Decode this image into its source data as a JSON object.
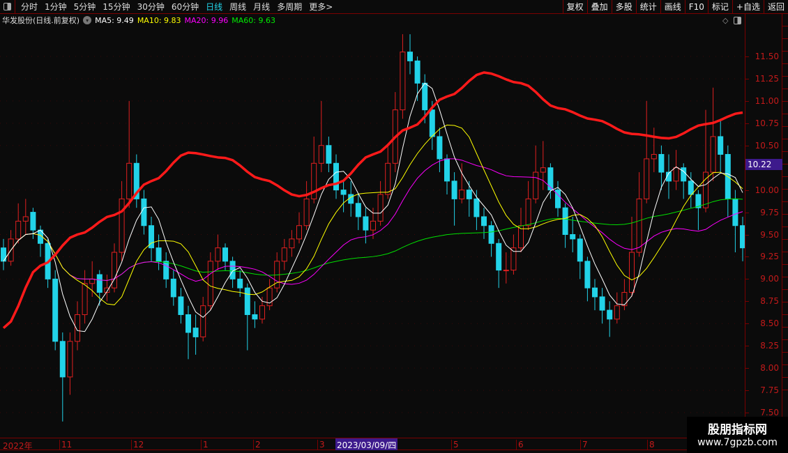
{
  "toolbar": {
    "periods": [
      "分时",
      "1分钟",
      "5分钟",
      "15分钟",
      "30分钟",
      "60分钟",
      "日线",
      "周线",
      "月线",
      "多周期",
      "更多>"
    ],
    "active_period": "日线",
    "buttons": [
      "复权",
      "叠加",
      "多股",
      "统计",
      "画线",
      "F10",
      "标记",
      "+自选",
      "返回"
    ]
  },
  "info": {
    "title": "华发股份(日线.前复权)",
    "ma5": "MA5: 9.49",
    "ma10": "MA10: 9.83",
    "ma20": "MA20: 9.96",
    "ma60": "MA60: 9.63"
  },
  "colors": {
    "up": "#e02020",
    "down": "#22d3e8",
    "ma5": "#ffffff",
    "ma10": "#ffff00",
    "ma20": "#ff00ff",
    "ma60": "#00e000",
    "thick_line": "#ff1a1a",
    "axis": "#c41a1a",
    "cursor": "#3d1a8c"
  },
  "price_axis": {
    "ticks": [
      "11.50",
      "11.25",
      "11.00",
      "10.75",
      "10.50",
      "10.00",
      "9.75",
      "9.50",
      "9.25",
      "9.00",
      "8.75",
      "8.50",
      "8.25",
      "8.00",
      "7.75",
      "7.50"
    ],
    "cursor_price": "10.22"
  },
  "time_axis": {
    "labels": [
      "2022年",
      "11",
      "12",
      "1",
      "2",
      "3",
      "4",
      "5",
      "6",
      "7",
      "8"
    ],
    "cursor_date": "2023/03/09/四"
  },
  "watermark": {
    "line1": "股朋指标网",
    "line2": "www.7gpzb.com"
  },
  "chart_data": {
    "type": "candlestick",
    "ylim": [
      7.5,
      11.5
    ],
    "bars": [
      [
        9.35,
        9.45,
        9.1,
        9.2
      ],
      [
        9.2,
        9.55,
        9.15,
        9.45
      ],
      [
        9.45,
        9.85,
        9.4,
        9.65
      ],
      [
        9.65,
        9.9,
        9.5,
        9.7
      ],
      [
        9.75,
        9.8,
        9.45,
        9.55
      ],
      [
        9.55,
        9.6,
        9.25,
        9.4
      ],
      [
        9.4,
        9.45,
        8.9,
        9.0
      ],
      [
        9.0,
        9.1,
        8.2,
        8.3
      ],
      [
        8.3,
        8.4,
        7.4,
        7.9
      ],
      [
        7.9,
        8.4,
        7.7,
        8.3
      ],
      [
        8.3,
        8.75,
        8.2,
        8.6
      ],
      [
        8.6,
        9.1,
        8.5,
        8.95
      ],
      [
        8.95,
        9.2,
        8.8,
        9.0
      ],
      [
        9.05,
        9.1,
        8.7,
        8.85
      ],
      [
        8.85,
        9.05,
        8.75,
        8.9
      ],
      [
        8.9,
        9.4,
        8.85,
        9.3
      ],
      [
        9.3,
        10.1,
        9.2,
        9.9
      ],
      [
        9.9,
        11.0,
        9.8,
        10.3
      ],
      [
        10.3,
        10.4,
        9.8,
        9.9
      ],
      [
        9.9,
        10.0,
        9.5,
        9.6
      ],
      [
        9.6,
        9.7,
        9.2,
        9.35
      ],
      [
        9.35,
        9.5,
        9.1,
        9.2
      ],
      [
        9.2,
        9.3,
        8.9,
        9.0
      ],
      [
        9.0,
        9.1,
        8.7,
        8.8
      ],
      [
        8.8,
        8.9,
        8.5,
        8.6
      ],
      [
        8.6,
        8.7,
        8.1,
        8.4
      ],
      [
        8.45,
        8.6,
        8.15,
        8.35
      ],
      [
        8.35,
        8.8,
        8.3,
        8.7
      ],
      [
        8.7,
        9.3,
        8.65,
        9.2
      ],
      [
        9.2,
        9.5,
        9.1,
        9.35
      ],
      [
        9.35,
        9.4,
        9.1,
        9.2
      ],
      [
        9.2,
        9.25,
        8.9,
        9.0
      ],
      [
        9.0,
        9.1,
        8.8,
        8.9
      ],
      [
        8.9,
        8.95,
        8.2,
        8.6
      ],
      [
        8.6,
        8.75,
        8.45,
        8.55
      ],
      [
        8.55,
        8.8,
        8.5,
        8.7
      ],
      [
        8.7,
        9.0,
        8.65,
        8.9
      ],
      [
        8.9,
        9.3,
        8.85,
        9.2
      ],
      [
        9.2,
        9.45,
        9.1,
        9.35
      ],
      [
        9.35,
        9.55,
        9.25,
        9.45
      ],
      [
        9.45,
        9.75,
        9.4,
        9.6
      ],
      [
        9.6,
        10.1,
        9.55,
        9.9
      ],
      [
        9.9,
        10.6,
        9.85,
        10.3
      ],
      [
        10.3,
        11.0,
        10.2,
        10.5
      ],
      [
        10.5,
        10.6,
        10.2,
        10.3
      ],
      [
        10.3,
        10.4,
        9.9,
        10.0
      ],
      [
        10.0,
        10.1,
        9.75,
        9.95
      ],
      [
        9.95,
        10.1,
        9.7,
        9.85
      ],
      [
        9.85,
        9.95,
        9.55,
        9.7
      ],
      [
        9.7,
        9.8,
        9.4,
        9.55
      ],
      [
        9.55,
        9.8,
        9.45,
        9.65
      ],
      [
        9.65,
        10.1,
        9.6,
        9.95
      ],
      [
        9.95,
        10.5,
        9.9,
        10.3
      ],
      [
        10.3,
        11.1,
        10.2,
        10.9
      ],
      [
        10.9,
        11.75,
        10.8,
        11.55
      ],
      [
        11.55,
        11.75,
        11.3,
        11.45
      ],
      [
        11.45,
        11.5,
        11.0,
        11.2
      ],
      [
        11.2,
        11.3,
        10.75,
        10.9
      ],
      [
        10.9,
        11.0,
        10.45,
        10.6
      ],
      [
        10.6,
        10.7,
        10.2,
        10.35
      ],
      [
        10.35,
        10.4,
        9.95,
        10.1
      ],
      [
        10.1,
        10.2,
        9.6,
        9.9
      ],
      [
        9.9,
        10.3,
        9.85,
        10.0
      ],
      [
        10.0,
        10.1,
        9.7,
        9.9
      ],
      [
        9.9,
        10.0,
        9.55,
        9.7
      ],
      [
        9.7,
        9.8,
        9.45,
        9.6
      ],
      [
        9.6,
        9.65,
        9.25,
        9.4
      ],
      [
        9.4,
        9.45,
        8.9,
        9.1
      ],
      [
        9.1,
        9.3,
        8.95,
        9.1
      ],
      [
        9.1,
        9.5,
        9.05,
        9.35
      ],
      [
        9.35,
        9.8,
        9.3,
        9.6
      ],
      [
        9.6,
        10.1,
        9.55,
        9.9
      ],
      [
        9.9,
        10.5,
        9.85,
        10.2
      ],
      [
        10.2,
        10.55,
        10.0,
        10.25
      ],
      [
        10.25,
        10.3,
        9.9,
        10.0
      ],
      [
        10.0,
        10.1,
        9.7,
        9.8
      ],
      [
        9.8,
        9.85,
        9.35,
        9.5
      ],
      [
        9.5,
        9.7,
        9.3,
        9.45
      ],
      [
        9.45,
        9.5,
        9.0,
        9.2
      ],
      [
        9.2,
        9.25,
        8.75,
        8.9
      ],
      [
        8.9,
        9.0,
        8.65,
        8.8
      ],
      [
        8.8,
        8.9,
        8.5,
        8.65
      ],
      [
        8.65,
        8.75,
        8.35,
        8.55
      ],
      [
        8.55,
        8.85,
        8.5,
        8.7
      ],
      [
        8.7,
        9.0,
        8.65,
        8.85
      ],
      [
        8.85,
        9.7,
        8.8,
        9.3
      ],
      [
        9.3,
        10.2,
        9.25,
        9.9
      ],
      [
        9.9,
        11.0,
        9.85,
        10.35
      ],
      [
        10.35,
        10.7,
        10.2,
        10.4
      ],
      [
        10.4,
        10.5,
        10.0,
        10.2
      ],
      [
        10.2,
        10.4,
        9.9,
        10.1
      ],
      [
        10.1,
        10.45,
        10.0,
        10.25
      ],
      [
        10.25,
        10.3,
        9.9,
        10.1
      ],
      [
        10.1,
        10.2,
        9.8,
        9.95
      ],
      [
        9.95,
        10.0,
        9.55,
        9.8
      ],
      [
        9.8,
        10.9,
        9.75,
        10.2
      ],
      [
        10.2,
        11.15,
        10.1,
        10.6
      ],
      [
        10.6,
        10.8,
        10.2,
        10.4
      ],
      [
        10.4,
        10.5,
        9.7,
        9.9
      ],
      [
        9.9,
        10.0,
        9.3,
        9.6
      ],
      [
        9.6,
        9.7,
        9.2,
        9.35
      ]
    ],
    "thick_line_every_5_bars": [
      8.45,
      9.15,
      9.5,
      9.72,
      10.1,
      10.42,
      10.36,
      10.12,
      9.93,
      10.07,
      10.4,
      10.7,
      11.05,
      11.32,
      11.2,
      10.92,
      10.79,
      10.63,
      10.58,
      10.74,
      10.87
    ]
  }
}
